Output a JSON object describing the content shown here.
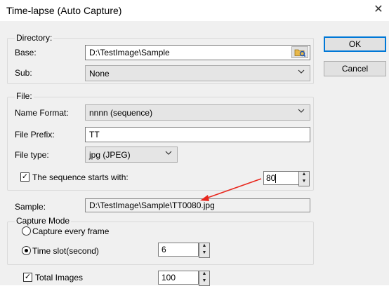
{
  "window": {
    "title": "Time-lapse (Auto Capture)",
    "close_glyph": "✕"
  },
  "buttons": {
    "ok": "OK",
    "cancel": "Cancel"
  },
  "directory": {
    "group_label": "Directory:",
    "base_label": "Base:",
    "base_value": "D:\\TestImage\\Sample",
    "sub_label": "Sub:",
    "sub_value": "None"
  },
  "file": {
    "group_label": "File:",
    "name_format_label": "Name Format:",
    "name_format_value": "nnnn (sequence)",
    "prefix_label": "File Prefix:",
    "prefix_value": "TT",
    "type_label": "File type:",
    "type_value": "jpg (JPEG)",
    "sequence_checkbox_label": "The sequence starts with:",
    "sequence_checked": true,
    "sequence_value": "80"
  },
  "sample": {
    "label": "Sample:",
    "value": "D:\\TestImage\\Sample\\TT0080.jpg"
  },
  "capture_mode": {
    "group_label": "Capture Mode",
    "every_frame_label": "Capture every frame",
    "time_slot_label": "Time slot(second)",
    "time_slot_selected": true,
    "time_slot_value": "6"
  },
  "total_images": {
    "label": "Total Images",
    "checked": true,
    "value": "100"
  },
  "icons": {
    "chevron": "chevron-down-icon",
    "spin_up": "spin-up-icon",
    "spin_down": "spin-down-icon",
    "folder": "folder-browse-icon"
  },
  "colors": {
    "annotation_arrow": "#e8271d",
    "default_button_border": "#0078d7"
  }
}
